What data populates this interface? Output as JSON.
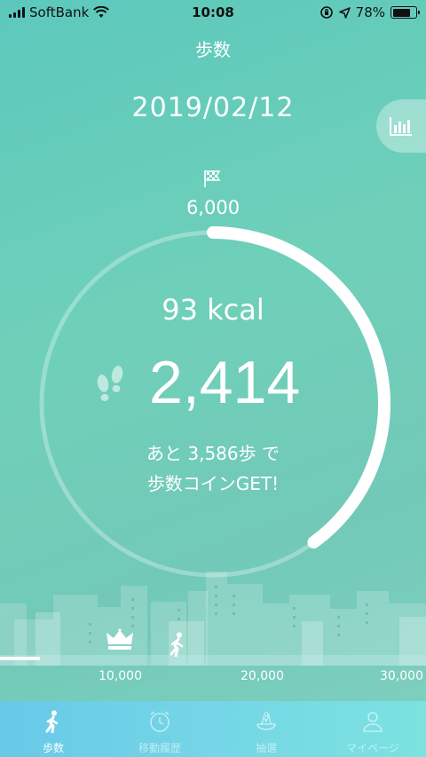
{
  "status_bar": {
    "carrier": "SoftBank",
    "time": "10:08",
    "battery_percent": "78%",
    "battery_level": 0.78
  },
  "header": {
    "title": "歩数",
    "date": "2019/02/12"
  },
  "goal": {
    "value": "6,000"
  },
  "summary": {
    "kcal": "93 kcal",
    "steps": "2,414",
    "remaining_line1": "あと 3,586歩 で",
    "remaining_line2": "歩数コインGET!",
    "goal_progress": 0.4
  },
  "milestones": {
    "ticks": [
      "10,000",
      "20,000",
      "30,000"
    ],
    "progress_steps": 2414
  },
  "tabs": [
    {
      "label": "歩数",
      "icon": "walk-icon",
      "active": true
    },
    {
      "label": "移動履歴",
      "icon": "clock-icon",
      "active": false
    },
    {
      "label": "抽選",
      "icon": "lottery-icon",
      "active": false
    },
    {
      "label": "マイページ",
      "icon": "person-icon",
      "active": false
    }
  ],
  "colors": {
    "background": "#6fd0b9",
    "tab_bar": "#74d6e6",
    "text": "#ffffff"
  }
}
